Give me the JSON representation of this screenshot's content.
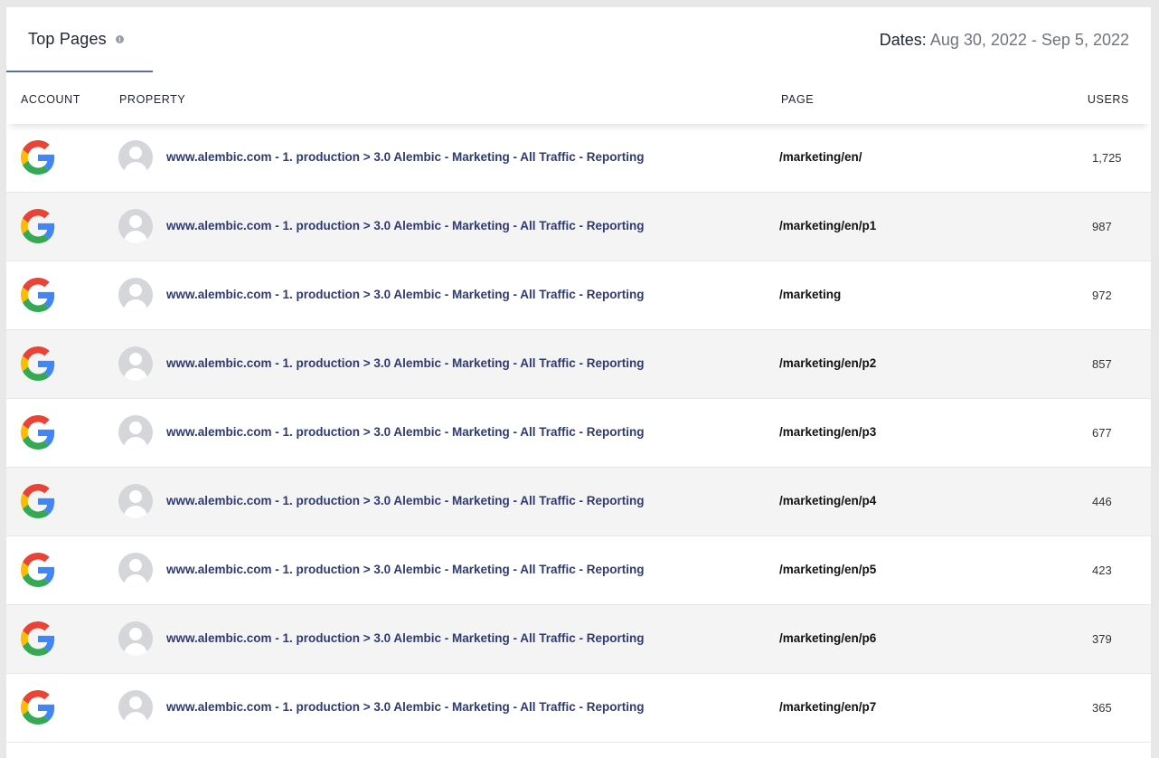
{
  "header": {
    "tab_title": "Top Pages",
    "dates_label": "Dates:",
    "dates_value": "Aug 30, 2022 - Sep 5, 2022"
  },
  "columns": {
    "account": "ACCOUNT",
    "property": "PROPERTY",
    "page": "PAGE",
    "users": "USERS"
  },
  "colors": {
    "tab_underline": "#5b6f9a",
    "property_link": "#2f3a73",
    "alt_row": "#f4f4f4"
  },
  "rows": [
    {
      "account_icon": "google-icon",
      "property": "www.alembic.com - 1. production > 3.0 Alembic - Marketing - All Traffic - Reporting",
      "page": "/marketing/en/",
      "users": "1,725"
    },
    {
      "account_icon": "google-icon",
      "property": "www.alembic.com - 1. production > 3.0 Alembic - Marketing - All Traffic - Reporting",
      "page": "/marketing/en/p1",
      "users": "987"
    },
    {
      "account_icon": "google-icon",
      "property": "www.alembic.com - 1. production > 3.0 Alembic - Marketing - All Traffic - Reporting",
      "page": "/marketing",
      "users": "972"
    },
    {
      "account_icon": "google-icon",
      "property": "www.alembic.com - 1. production > 3.0 Alembic - Marketing - All Traffic - Reporting",
      "page": "/marketing/en/p2",
      "users": "857"
    },
    {
      "account_icon": "google-icon",
      "property": "www.alembic.com - 1. production > 3.0 Alembic - Marketing - All Traffic - Reporting",
      "page": "/marketing/en/p3",
      "users": "677"
    },
    {
      "account_icon": "google-icon",
      "property": "www.alembic.com - 1. production > 3.0 Alembic - Marketing - All Traffic - Reporting",
      "page": "/marketing/en/p4",
      "users": "446"
    },
    {
      "account_icon": "google-icon",
      "property": "www.alembic.com - 1. production > 3.0 Alembic - Marketing - All Traffic - Reporting",
      "page": "/marketing/en/p5",
      "users": "423"
    },
    {
      "account_icon": "google-icon",
      "property": "www.alembic.com - 1. production > 3.0 Alembic - Marketing - All Traffic - Reporting",
      "page": "/marketing/en/p6",
      "users": "379"
    },
    {
      "account_icon": "google-icon",
      "property": "www.alembic.com - 1. production > 3.0 Alembic - Marketing - All Traffic - Reporting",
      "page": "/marketing/en/p7",
      "users": "365"
    }
  ]
}
